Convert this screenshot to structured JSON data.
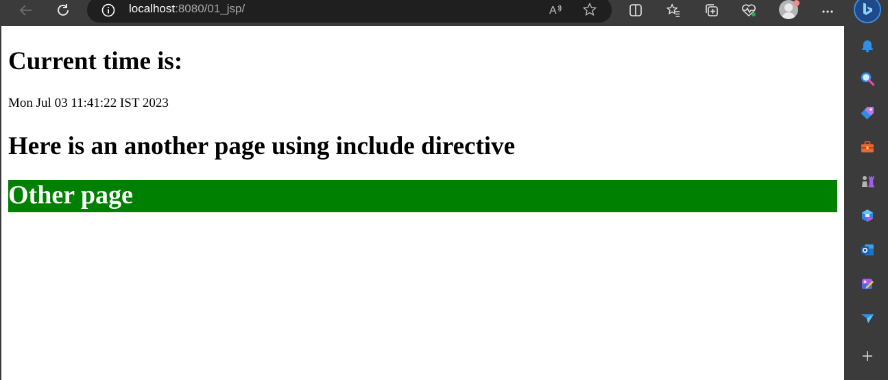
{
  "browser": {
    "url_host": "localhost",
    "url_path": ":8080/01_jsp/",
    "toolbar_icons": [
      "back-arrow-icon",
      "refresh-icon",
      "info-icon",
      "read-aloud-icon",
      "favorite-star-icon",
      "split-screen-icon",
      "favorites-icon",
      "collections-icon",
      "browser-essentials-icon",
      "profile-avatar",
      "more-options-icon",
      "bing-copilot-icon"
    ],
    "sidebar_icons": [
      "bell-icon",
      "search-icon",
      "shopping-tag-icon",
      "tools-icon",
      "games-icon",
      "microsoft-365-icon",
      "outlook-icon",
      "designer-icon",
      "drop-icon",
      "add-icon"
    ]
  },
  "page": {
    "heading_current_time": "Current time is:",
    "current_time": "Mon Jul 03 11:41:22 IST 2023",
    "heading_include": "Here is an another page using include directive",
    "included_heading": "Other page"
  },
  "colors": {
    "toolbar_bg": "#3b3b3b",
    "address_bg": "#1f1f1f",
    "included_block_bg": "#008000",
    "included_text": "#ffffff"
  }
}
